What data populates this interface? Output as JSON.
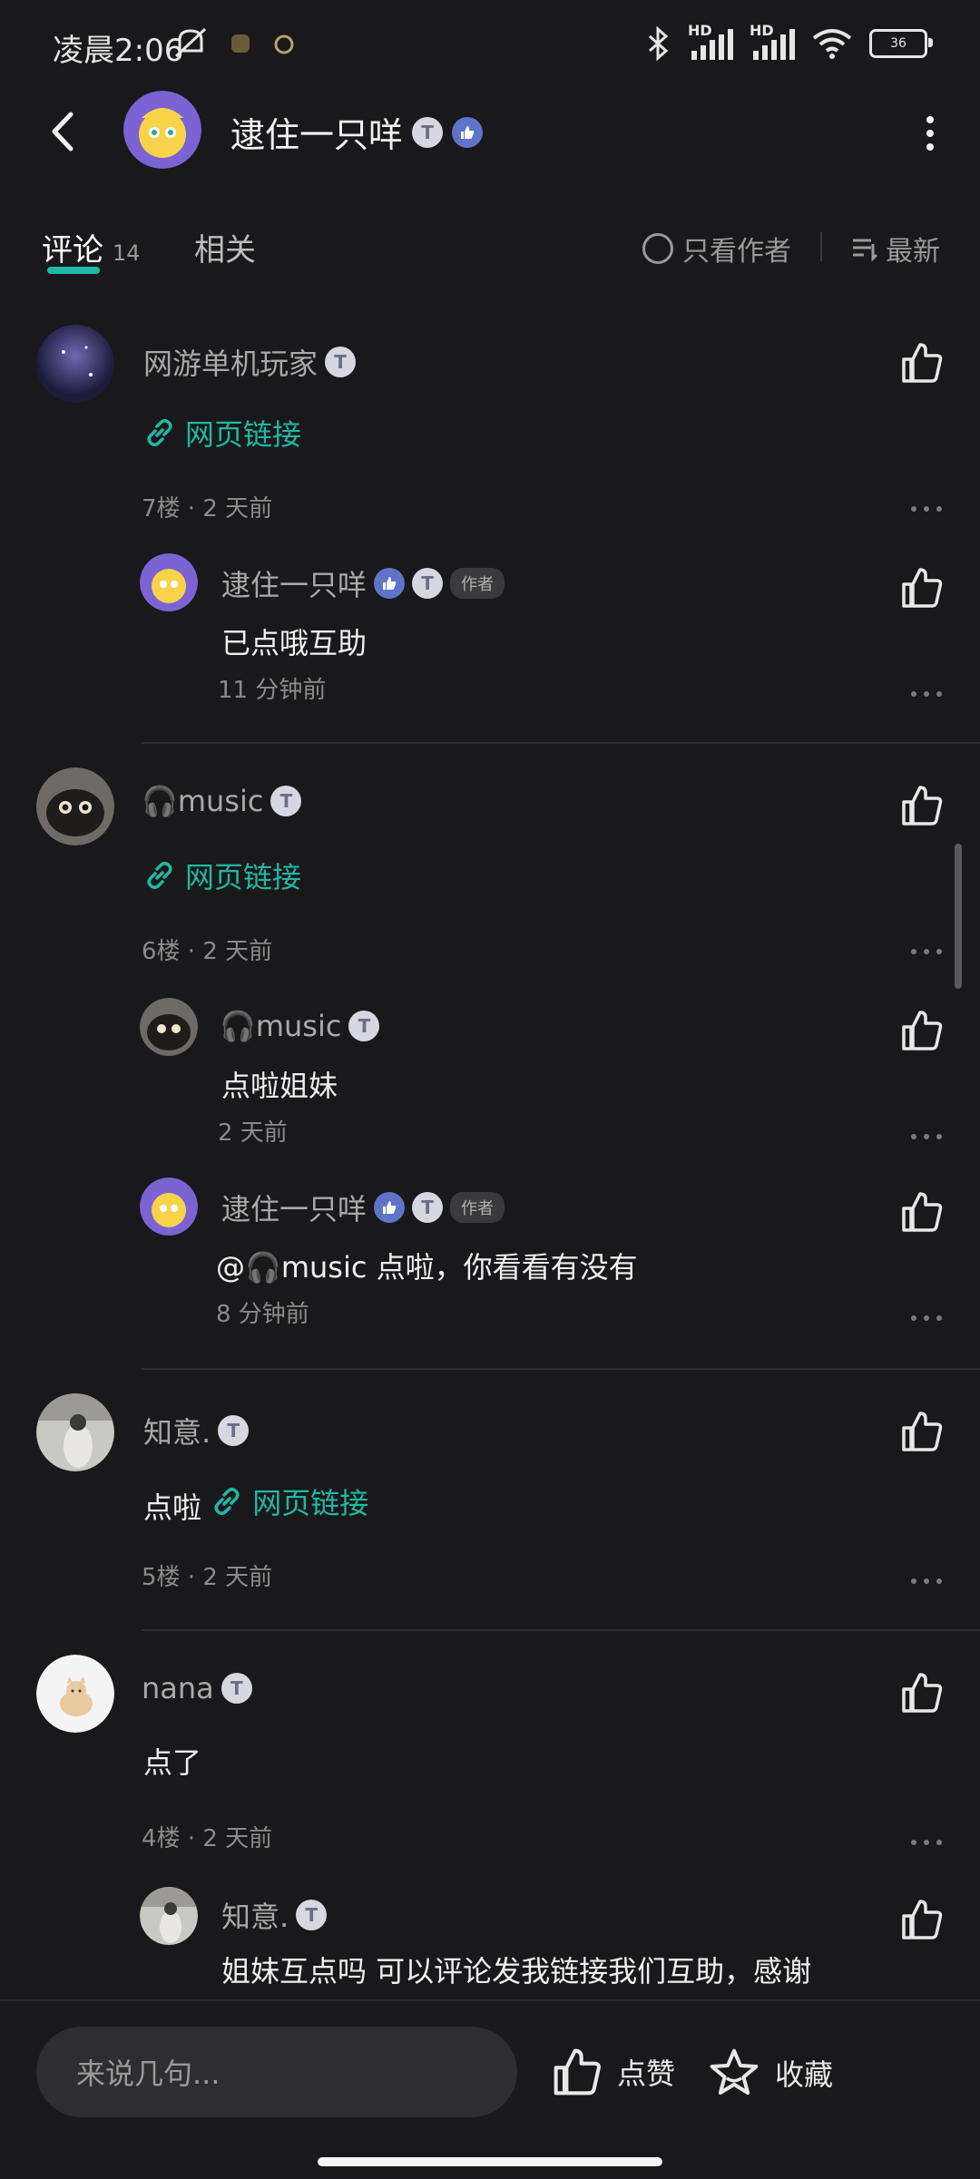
{
  "status_bar": {
    "time": "凌晨2:06",
    "network_label_1": "HD",
    "network_label_2": "HD",
    "battery": "36"
  },
  "header": {
    "title": "逮住一只咩"
  },
  "tabs": {
    "comments_label": "评论",
    "comments_count": "14",
    "related_label": "相关",
    "only_author_label": "只看作者",
    "sort_label": "最新"
  },
  "comments": [
    {
      "username": "网游单机玩家",
      "link_text": "网页链接",
      "meta": "7楼 · 2 天前",
      "replies": [
        {
          "username": "逮住一只咩",
          "author_badge": "作者",
          "text": "已点哦互助",
          "meta": "11 分钟前"
        }
      ]
    },
    {
      "username": "🎧music",
      "link_text": "网页链接",
      "meta": "6楼 · 2 天前",
      "replies": [
        {
          "username": "🎧music",
          "text": "点啦姐妹",
          "meta": "2 天前"
        },
        {
          "username": "逮住一只咩",
          "author_badge": "作者",
          "text": "@🎧music 点啦，你看看有没有",
          "meta": "8 分钟前"
        }
      ]
    },
    {
      "username": "知意.",
      "text_prefix": "点啦",
      "link_text": "网页链接",
      "meta": "5楼 · 2 天前"
    },
    {
      "username": "nana",
      "text": "点了",
      "meta": "4楼 · 2 天前",
      "replies": [
        {
          "username": "知意.",
          "text": "姐妹互点吗 可以评论发我链接我们互助，感谢"
        }
      ]
    }
  ],
  "bottom_bar": {
    "input_placeholder": "来说几句...",
    "like_label": "点赞",
    "collect_label": "收藏"
  },
  "colors": {
    "background": "#19181a",
    "accent": "#20b8a3",
    "badge_like": "#5f73c9"
  }
}
